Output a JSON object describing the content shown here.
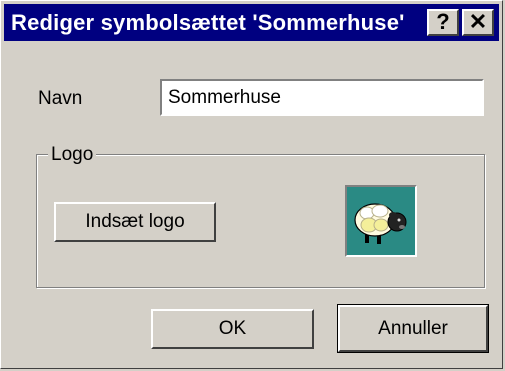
{
  "dialog": {
    "title": "Rediger symbolsættet 'Sommerhuse'",
    "help_symbol": "?",
    "close_symbol": "✕"
  },
  "form": {
    "name_label": "Navn",
    "name_value": "Sommerhuse"
  },
  "logo_group": {
    "legend": "Logo",
    "insert_button_label": "Indsæt logo",
    "logo_icon": "sheep-icon",
    "logo_background": "#2a8a84"
  },
  "buttons": {
    "ok_label": "OK",
    "cancel_label": "Annuller"
  },
  "colors": {
    "titlebar": "#000080",
    "face": "#d4d0c8"
  }
}
